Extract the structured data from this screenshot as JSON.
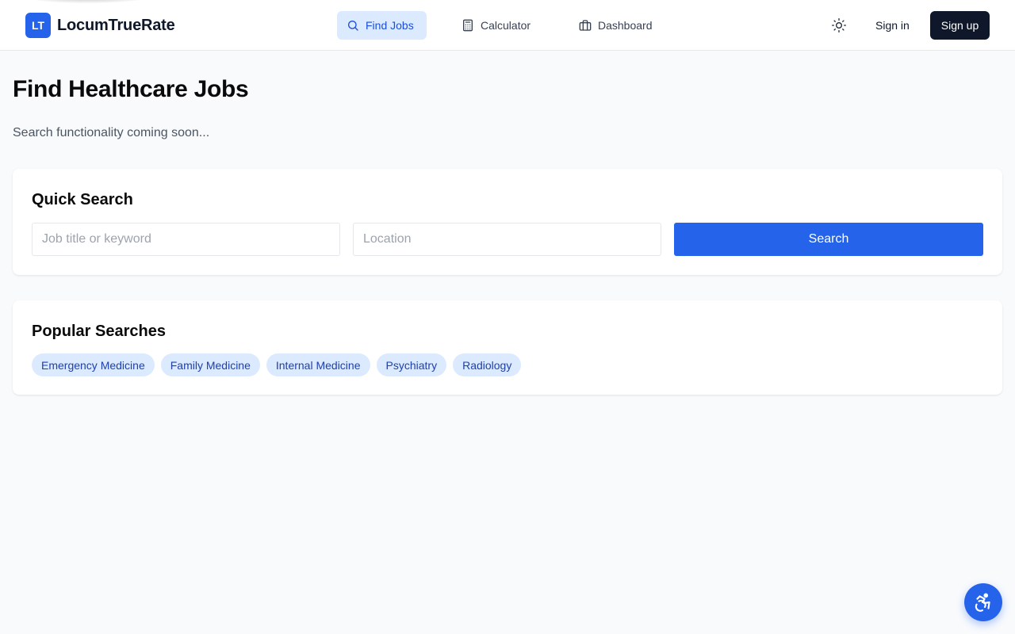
{
  "header": {
    "logo_badge": "LT",
    "brand": "LocumTrueRate",
    "nav": [
      {
        "label": "Find Jobs",
        "icon": "search-icon",
        "active": true
      },
      {
        "label": "Calculator",
        "icon": "calculator-icon",
        "active": false
      },
      {
        "label": "Dashboard",
        "icon": "briefcase-icon",
        "active": false
      }
    ],
    "theme_icon": "sun-icon",
    "signin_label": "Sign in",
    "signup_label": "Sign up"
  },
  "main": {
    "title": "Find Healthcare Jobs",
    "subtitle": "Search functionality coming soon...",
    "quick_search": {
      "title": "Quick Search",
      "job_placeholder": "Job title or keyword",
      "location_placeholder": "Location",
      "job_value": "",
      "location_value": "",
      "button_label": "Search"
    },
    "popular": {
      "title": "Popular Searches",
      "tags": [
        "Emergency Medicine",
        "Family Medicine",
        "Internal Medicine",
        "Psychiatry",
        "Radiology"
      ]
    }
  },
  "accessibility_button": {
    "icon": "accessibility-icon"
  },
  "colors": {
    "primary": "#2563eb",
    "dark": "#0f172a",
    "tag_bg": "#dbeafe",
    "tag_text": "#1e40af",
    "background": "#f8fafc"
  }
}
